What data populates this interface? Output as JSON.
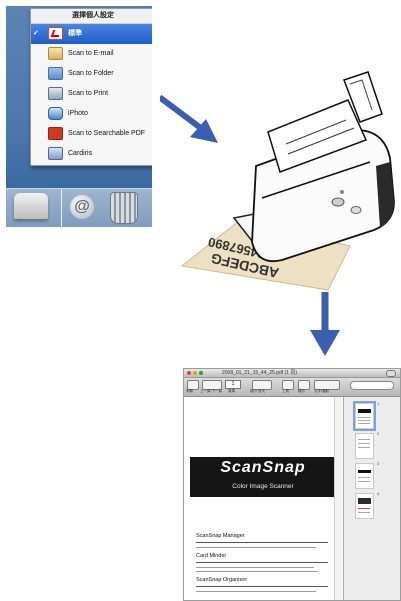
{
  "menu": {
    "title": "選擇個人設定",
    "items": [
      {
        "label": "標準",
        "icon": "pdf-icon",
        "selected": true
      },
      {
        "label": "Scan to E-mail",
        "icon": "mail-icon",
        "selected": false
      },
      {
        "label": "Scan to Folder",
        "icon": "folder-icon",
        "selected": false
      },
      {
        "label": "Scan to Print",
        "icon": "printer-icon",
        "selected": false
      },
      {
        "label": "iPhoto",
        "icon": "iphoto-icon",
        "selected": false
      },
      {
        "label": "Scan to Searchable PDF",
        "icon": "searchable-pdf-icon",
        "selected": false
      },
      {
        "label": "Cardiris",
        "icon": "cardiris-icon",
        "selected": false
      }
    ]
  },
  "scanned_sheet": {
    "line1": "1234567890",
    "line2": "ABCDEFG"
  },
  "viewer": {
    "title": "2008_01_21_15_44_25.pdf (1 頁)",
    "page_field": "1",
    "toolbar": {
      "drawer_label": "側欄",
      "prevnext_label": "上一頁/下一頁",
      "page_label": "頁碼",
      "zoom_label": "縮小 放大",
      "tool_label": "工具",
      "display_label": "顯示",
      "select_label": "文字/選取"
    },
    "sidebar": {
      "thumb_numbers": [
        "1",
        "2",
        "3",
        "4"
      ]
    },
    "document": {
      "brand": "ScanSnap",
      "tagline": "Color Image Scanner",
      "sections": [
        "ScanSnap Manager",
        "Card Minder",
        "ScanSnap Organizer"
      ]
    }
  },
  "colors": {
    "arrow": "#3b5fb0",
    "menu_selected": "#2a66d6",
    "paper": "#eee1c3",
    "banner": "#151515"
  }
}
